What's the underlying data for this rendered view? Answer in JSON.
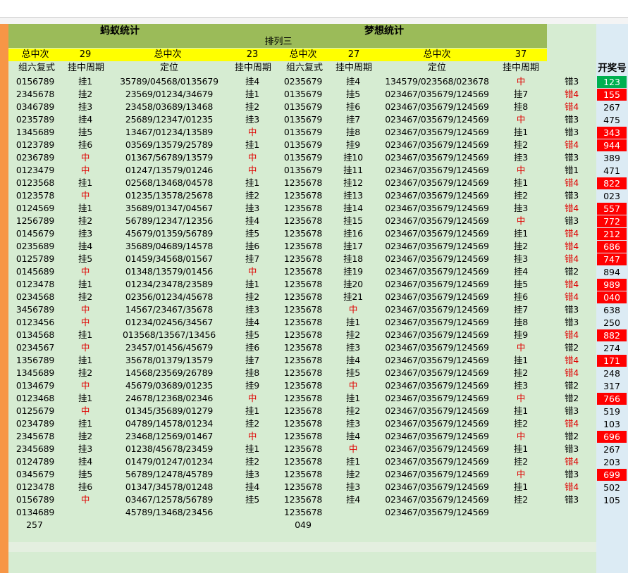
{
  "header": {
    "ant_title": "蚂蚁统计",
    "dream_title": "梦想统计",
    "subtitle": "排列三"
  },
  "summary": [
    {
      "label": "总中次",
      "value": "29"
    },
    {
      "label": "总中次",
      "value": "23"
    },
    {
      "label": "总中次",
      "value": "27"
    },
    {
      "label": "总中次",
      "value": "37"
    }
  ],
  "columns": {
    "c1": "组六复式",
    "c2": "挂中周期",
    "c3": "定位",
    "c4": "挂中周期",
    "c5": "组六复式",
    "c6": "挂中周期",
    "c7": "定位",
    "c8": "挂中周期",
    "c10": "开奖号"
  },
  "colors": {
    "red_text": "#e00000",
    "red_fill": "#ff0000",
    "green_fill": "#00b050",
    "olive": "#9bbb59",
    "yellow": "#ffff00",
    "sheet": "#d6ecd2"
  },
  "rows": [
    [
      "0156789",
      "挂1",
      "35789/04568/0135679",
      "挂4",
      "0235679",
      "挂4",
      "134579/023568/023678",
      "中",
      "错3",
      "123",
      "green"
    ],
    [
      "2345678",
      "挂2",
      "23569/01234/34679",
      "挂1",
      "0135679",
      "挂5",
      "023467/035679/124569",
      "挂7",
      "错4",
      "155",
      "red"
    ],
    [
      "0346789",
      "挂3",
      "23458/03689/13468",
      "挂2",
      "0135679",
      "挂6",
      "023467/035679/124569",
      "挂8",
      "错4",
      "267",
      ""
    ],
    [
      "0235789",
      "挂4",
      "25689/12347/01235",
      "挂3",
      "0135679",
      "挂7",
      "023467/035679/124569",
      "中",
      "错3",
      "475",
      ""
    ],
    [
      "1345689",
      "挂5",
      "13467/01234/13589",
      "中",
      "0135679",
      "挂8",
      "023467/035679/124569",
      "挂1",
      "错3",
      "343",
      "red"
    ],
    [
      "0123789",
      "挂6",
      "03569/13579/25789",
      "挂1",
      "0135679",
      "挂9",
      "023467/035679/124569",
      "挂2",
      "错4",
      "944",
      "red"
    ],
    [
      "0236789",
      "中",
      "01367/56789/13579",
      "中",
      "0135679",
      "挂10",
      "023467/035679/124569",
      "挂3",
      "错3",
      "389",
      ""
    ],
    [
      "0123479",
      "中",
      "01247/13579/01246",
      "中",
      "0135679",
      "挂11",
      "023467/035679/124569",
      "中",
      "错1",
      "471",
      ""
    ],
    [
      "0123568",
      "挂1",
      "02568/13468/04578",
      "挂1",
      "1235678",
      "挂12",
      "023467/035679/124569",
      "挂1",
      "错4",
      "822",
      "red"
    ],
    [
      "0123578",
      "中",
      "01235/13578/25678",
      "挂2",
      "1235678",
      "挂13",
      "023467/035679/124569",
      "挂2",
      "错3",
      "023",
      ""
    ],
    [
      "0124569",
      "挂1",
      "35689/01347/04567",
      "挂3",
      "1235678",
      "挂14",
      "023467/035679/124569",
      "挂3",
      "错4",
      "557",
      "red"
    ],
    [
      "1256789",
      "挂2",
      "56789/12347/12356",
      "挂4",
      "1235678",
      "挂15",
      "023467/035679/124569",
      "中",
      "错3",
      "772",
      "red"
    ],
    [
      "0145679",
      "挂3",
      "45679/01359/56789",
      "挂5",
      "1235678",
      "挂16",
      "023467/035679/124569",
      "挂1",
      "错4",
      "212",
      "red"
    ],
    [
      "0235689",
      "挂4",
      "35689/04689/14578",
      "挂6",
      "1235678",
      "挂17",
      "023467/035679/124569",
      "挂2",
      "错4",
      "686",
      "red"
    ],
    [
      "0125789",
      "挂5",
      "01459/34568/01567",
      "挂7",
      "1235678",
      "挂18",
      "023467/035679/124569",
      "挂3",
      "错4",
      "747",
      "red"
    ],
    [
      "0145689",
      "中",
      "01348/13579/01456",
      "中",
      "1235678",
      "挂19",
      "023467/035679/124569",
      "挂4",
      "错2",
      "894",
      ""
    ],
    [
      "0123478",
      "挂1",
      "01234/23478/23589",
      "挂1",
      "1235678",
      "挂20",
      "023467/035679/124569",
      "挂5",
      "错4",
      "989",
      "red"
    ],
    [
      "0234568",
      "挂2",
      "02356/01234/45678",
      "挂2",
      "1235678",
      "挂21",
      "023467/035679/124569",
      "挂6",
      "错4",
      "040",
      "red"
    ],
    [
      "3456789",
      "中",
      "14567/23467/35678",
      "挂3",
      "1235678",
      "中",
      "023467/035679/124569",
      "挂7",
      "错3",
      "638",
      ""
    ],
    [
      "0123456",
      "中",
      "01234/02456/34567",
      "挂4",
      "1235678",
      "挂1",
      "023467/035679/124569",
      "挂8",
      "错3",
      "250",
      ""
    ],
    [
      "0134568",
      "挂1",
      "013568/13567/13456",
      "挂5",
      "1235678",
      "挂2",
      "023467/035679/124569",
      "挂9",
      "错4",
      "882",
      "red"
    ],
    [
      "0234567",
      "中",
      "23457/01456/45679",
      "挂6",
      "1235678",
      "挂3",
      "023467/035679/124569",
      "中",
      "错2",
      "274",
      ""
    ],
    [
      "1356789",
      "挂1",
      "35678/01379/13579",
      "挂7",
      "1235678",
      "挂4",
      "023467/035679/124569",
      "挂1",
      "错4",
      "171",
      "red"
    ],
    [
      "1345689",
      "挂2",
      "14568/23569/26789",
      "挂8",
      "1235678",
      "挂5",
      "023467/035679/124569",
      "挂2",
      "错4",
      "248",
      ""
    ],
    [
      "0134679",
      "中",
      "45679/03689/01235",
      "挂9",
      "1235678",
      "中",
      "023467/035679/124569",
      "挂3",
      "错2",
      "317",
      ""
    ],
    [
      "0123468",
      "挂1",
      "24678/12368/02346",
      "中",
      "1235678",
      "挂1",
      "023467/035679/124569",
      "中",
      "错2",
      "766",
      "red"
    ],
    [
      "0125679",
      "中",
      "01345/35689/01279",
      "挂1",
      "1235678",
      "挂2",
      "023467/035679/124569",
      "挂1",
      "错3",
      "519",
      ""
    ],
    [
      "0234789",
      "挂1",
      "04789/14578/01234",
      "挂2",
      "1235678",
      "挂3",
      "023467/035679/124569",
      "挂2",
      "错4",
      "103",
      ""
    ],
    [
      "2345678",
      "挂2",
      "23468/12569/01467",
      "中",
      "1235678",
      "挂4",
      "023467/035679/124569",
      "中",
      "错2",
      "696",
      "red"
    ],
    [
      "2345689",
      "挂3",
      "01238/45678/23459",
      "挂1",
      "1235678",
      "中",
      "023467/035679/124569",
      "挂1",
      "错3",
      "267",
      ""
    ],
    [
      "0124789",
      "挂4",
      "01479/01247/01234",
      "挂2",
      "1235678",
      "挂1",
      "023467/035679/124569",
      "挂2",
      "错4",
      "203",
      ""
    ],
    [
      "0345679",
      "挂5",
      "56789/12478/45789",
      "挂3",
      "1235678",
      "挂2",
      "023467/035679/124569",
      "中",
      "错3",
      "699",
      "red"
    ],
    [
      "0123478",
      "挂6",
      "01347/34578/01248",
      "挂4",
      "1235678",
      "挂3",
      "023467/035679/124569",
      "挂1",
      "错4",
      "502",
      ""
    ],
    [
      "0156789",
      "中",
      "03467/12578/56789",
      "挂5",
      "1235678",
      "挂4",
      "023467/035679/124569",
      "挂2",
      "错3",
      "105",
      ""
    ],
    [
      "0134689",
      "",
      "45789/13468/23456",
      "",
      "1235678",
      "",
      "023467/035679/124569",
      "",
      "",
      "",
      ""
    ]
  ],
  "footer": {
    "left_number": "257",
    "mid_number": "049"
  }
}
